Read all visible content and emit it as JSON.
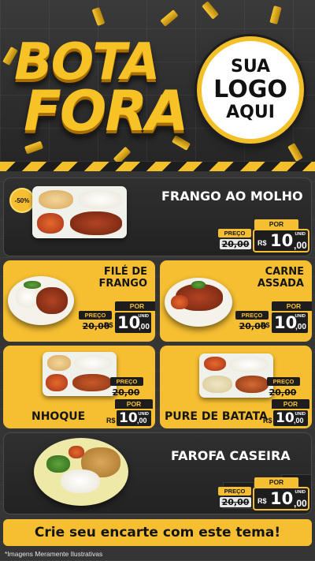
{
  "header": {
    "title_line1": "BOTA",
    "title_line2": "FORA",
    "logo_line1": "SUA",
    "logo_line2": "LOGO",
    "logo_line3": "AQUI"
  },
  "colors": {
    "accent": "#f6bf31",
    "dark": "#1d1d1d",
    "background": "#353535"
  },
  "discount_badge": "-50%",
  "products": [
    {
      "name": "FRANGO AO MOLHO",
      "preco_label": "PREÇO",
      "por_label": "POR",
      "old_price": "20,00",
      "currency": "R$",
      "price_int": "10",
      "price_cents": ",00",
      "unit": "UNID"
    },
    {
      "name_line1": "FILÉ DE",
      "name_line2": "FRANGO",
      "preco_label": "PREÇO",
      "por_label": "POR",
      "old_price": "20,00",
      "currency": "R$",
      "price_int": "10",
      "price_cents": ",00",
      "unit": "UNID"
    },
    {
      "name_line1": "CARNE",
      "name_line2": "ASSADA",
      "preco_label": "PREÇO",
      "por_label": "POR",
      "old_price": "20,00",
      "currency": "R$",
      "price_int": "10",
      "price_cents": ",00",
      "unit": "UNID"
    },
    {
      "name": "NHOQUE",
      "preco_label": "PREÇO",
      "por_label": "POR",
      "old_price": "20,00",
      "currency": "R$",
      "price_int": "10",
      "price_cents": ",00",
      "unit": "UNID"
    },
    {
      "name": "PURE DE BATATA",
      "preco_label": "PREÇO",
      "por_label": "POR",
      "old_price": "20,00",
      "currency": "R$",
      "price_int": "10",
      "price_cents": ",00",
      "unit": "UNID"
    },
    {
      "name": "FAROFA CASEIRA",
      "preco_label": "PREÇO",
      "por_label": "POR",
      "old_price": "20,00",
      "currency": "R$",
      "price_int": "10",
      "price_cents": ",00",
      "unit": "UNID"
    }
  ],
  "cta": "Crie seu encarte com este tema!",
  "disclaimer": "*Imagens Meramente Ilustrativas"
}
